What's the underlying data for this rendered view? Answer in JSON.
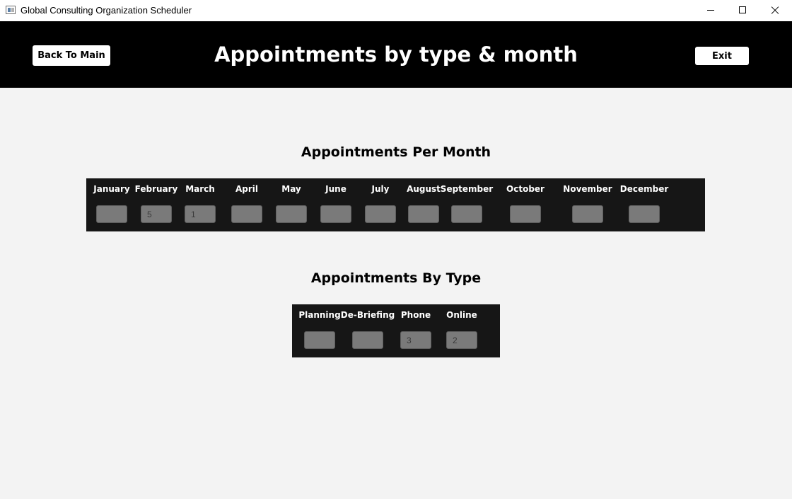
{
  "window": {
    "title": "Global Consulting Organization Scheduler",
    "icon": "app-window-icon"
  },
  "header": {
    "title": "Appointments by type & month",
    "back_label": "Back To Main",
    "exit_label": "Exit"
  },
  "months_section": {
    "heading": "Appointments Per Month",
    "months": [
      {
        "label": "January",
        "value": ""
      },
      {
        "label": "February",
        "value": "5"
      },
      {
        "label": "March",
        "value": "1"
      },
      {
        "label": "April",
        "value": ""
      },
      {
        "label": "May",
        "value": ""
      },
      {
        "label": "June",
        "value": ""
      },
      {
        "label": "July",
        "value": ""
      },
      {
        "label": "August",
        "value": ""
      },
      {
        "label": "September",
        "value": ""
      },
      {
        "label": "October",
        "value": ""
      },
      {
        "label": "November",
        "value": ""
      },
      {
        "label": "December",
        "value": ""
      }
    ]
  },
  "types_section": {
    "heading": "Appointments By Type",
    "types": [
      {
        "label": "Planning",
        "value": ""
      },
      {
        "label": "De-Briefing",
        "value": ""
      },
      {
        "label": "Phone",
        "value": "3"
      },
      {
        "label": "Online",
        "value": "2"
      }
    ]
  },
  "colors": {
    "header_bg": "#000000",
    "panel_bg": "#161616",
    "field_bg": "#7a7a7a",
    "page_bg": "#f3f3f3"
  }
}
